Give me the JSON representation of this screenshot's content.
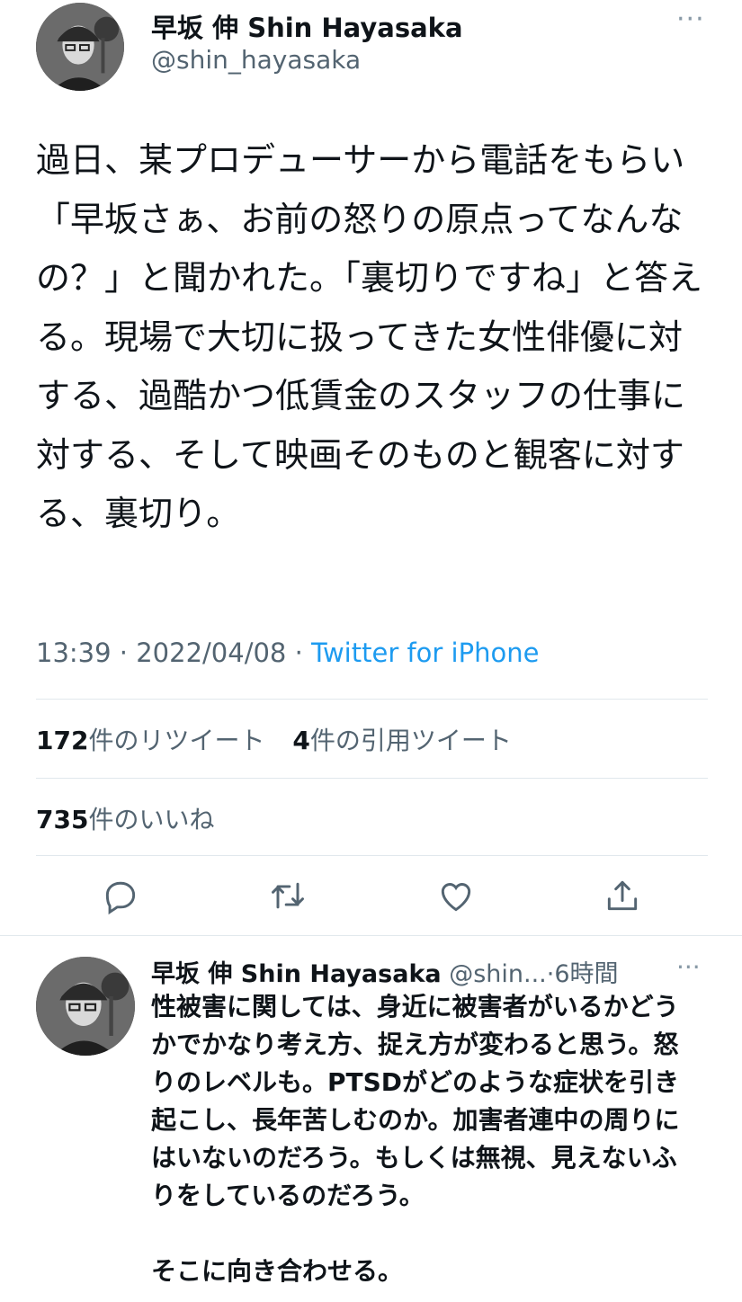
{
  "main_tweet": {
    "display_name": "早坂 伸 Shin Hayasaka",
    "handle": "@shin_hayasaka",
    "more": "···",
    "text": "過日、某プロデューサーから電話をもらい「早坂さぁ、お前の怒りの原点ってなんなの？」と聞かれた。「裏切りですね」と答える。現場で大切に扱ってきた女性俳優に対する、過酷かつ低賃金のスタッフの仕事に対する、そして映画そのものと観客に対する、裏切り。",
    "time": "13:39",
    "date": "2022/04/08",
    "source": "Twitter for iPhone",
    "meta_sep": "·",
    "retweets_count": "172",
    "retweets_label": "件のリツイート",
    "quotes_count": "4",
    "quotes_label": "件の引用ツイート",
    "likes_count": "735",
    "likes_label": "件のいいね"
  },
  "actions": {
    "reply_icon": "reply-icon",
    "retweet_icon": "retweet-icon",
    "like_icon": "heart-icon",
    "share_icon": "share-icon"
  },
  "reply_tweet": {
    "display_name": "早坂 伸 Shin Hayasaka",
    "handle": "@shin...",
    "separator": "·",
    "time_ago": "6時間",
    "more": "···",
    "text": "性被害に関しては、身近に被害者がいるかどうかでかなり考え方、捉え方が変わると思う。怒りのレベルも。PTSDがどのような症状を引き起こし、長年苦しむのか。加害者連中の周りにはいないのだろう。もしくは無視、見えないふりをしているのだろう。\n\nそこに向き合わせる。"
  },
  "colors": {
    "text": "#0f1419",
    "secondary": "#536471",
    "link": "#1d9bf0",
    "divider": "#e1e8ed"
  }
}
